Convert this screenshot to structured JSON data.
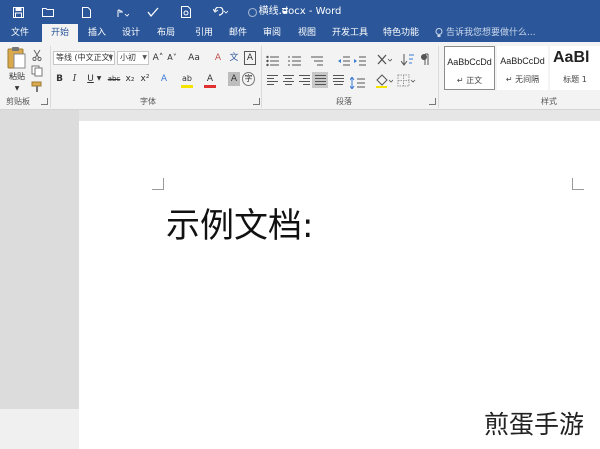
{
  "window": {
    "title": "横线.docx - Word"
  },
  "tabs": [
    {
      "label": "文件",
      "active": false
    },
    {
      "label": "开始",
      "active": true
    },
    {
      "label": "插入",
      "active": false
    },
    {
      "label": "设计",
      "active": false
    },
    {
      "label": "布局",
      "active": false
    },
    {
      "label": "引用",
      "active": false
    },
    {
      "label": "邮件",
      "active": false
    },
    {
      "label": "审阅",
      "active": false
    },
    {
      "label": "视图",
      "active": false
    },
    {
      "label": "开发工具",
      "active": false
    },
    {
      "label": "特色功能",
      "active": false
    }
  ],
  "tell_me": {
    "placeholder": "告诉我您想要做什么..."
  },
  "ribbon": {
    "clipboard": {
      "paste_label": "粘贴",
      "group_label": "剪贴板"
    },
    "font": {
      "group_label": "字体",
      "font_name": "等线 (中文正文)",
      "font_size": "小初",
      "bold": "B",
      "italic": "I",
      "underline": "U",
      "strike": "abc",
      "subscript": "x₂",
      "superscript": "x²",
      "grow": "A˄",
      "shrink": "A˅",
      "case": "Aa",
      "clear": "A",
      "phonetic": "文",
      "border_char": "A",
      "effects": "A",
      "highlight": "ab",
      "font_color": "A",
      "shade": "A",
      "enclose": "字"
    },
    "paragraph": {
      "group_label": "段落"
    },
    "styles": {
      "group_label": "样式",
      "items": [
        {
          "sample": "AaBbCcDd",
          "name": "↵ 正文"
        },
        {
          "sample": "AaBbCcDd",
          "name": "↵ 无间隔"
        },
        {
          "sample": "AaBl",
          "name": "标题 1"
        }
      ]
    }
  },
  "document": {
    "text": "示例文档:"
  },
  "watermark": {
    "text": "煎蛋手游"
  },
  "colors": {
    "title_bar": "#2b579a",
    "ribbon": "#f3f3f3",
    "page": "#ffffff",
    "font_color_bar": "#e03030",
    "highlight_bar": "#f5e400"
  }
}
